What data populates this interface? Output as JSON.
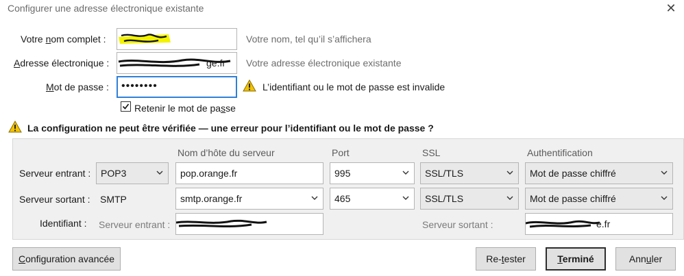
{
  "window": {
    "title": "Configurer une adresse électronique existante",
    "close_glyph": "✕"
  },
  "form": {
    "name": {
      "label_prefix": "Votre ",
      "label_accel": "n",
      "label_rest": "om complet :",
      "hint": "Votre nom, tel qu’il s’affichera"
    },
    "email": {
      "label_accel": "A",
      "label_rest": "dresse électronique :",
      "visible_tail": "ge.fr",
      "hint": "Votre adresse électronique existante"
    },
    "password": {
      "label_accel": "M",
      "label_rest": "ot de passe :",
      "value": "••••••••",
      "error": "L’identifiant ou le mot de passe est invalide"
    },
    "remember": {
      "label_prefix": "Retenir le mot de pa",
      "label_accel": "s",
      "label_rest": "se",
      "checked": true
    }
  },
  "warning_message": "La configuration ne peut être vérifiée — une erreur pour l’identifiant ou le mot de passe ?",
  "server": {
    "headers": {
      "hostname": "Nom d’hôte du serveur",
      "port": "Port",
      "ssl": "SSL",
      "auth": "Authentification"
    },
    "incoming": {
      "label": "Serveur entrant :",
      "protocol": "POP3",
      "hostname": "pop.orange.fr",
      "port": "995",
      "ssl": "SSL/TLS",
      "auth": "Mot de passe chiffré"
    },
    "outgoing": {
      "label": "Serveur sortant :",
      "protocol": "SMTP",
      "hostname": "smtp.orange.fr",
      "port": "465",
      "ssl": "SSL/TLS",
      "auth": "Mot de passe chiffré"
    },
    "identifier": {
      "label": "Identifiant :",
      "incoming_label": "Serveur entrant :",
      "outgoing_label": "Serveur sortant :",
      "outgoing_tail": "e.fr"
    }
  },
  "buttons": {
    "advanced": {
      "accel": "C",
      "rest": "onfiguration avancée"
    },
    "retest": {
      "prefix": "Re-",
      "accel": "t",
      "rest": "ester"
    },
    "done": {
      "accel": "T",
      "rest": "erminé"
    },
    "cancel": {
      "prefix": "Ann",
      "accel": "u",
      "rest": "ler"
    }
  },
  "colors": {
    "highlight": "#f3f300",
    "focus": "#2f7fd8",
    "warning": "#f2c200"
  },
  "icons": {
    "warning": "warning-icon",
    "close": "close-icon",
    "dropdown": "chevron-down-icon",
    "check": "checkmark-icon"
  }
}
